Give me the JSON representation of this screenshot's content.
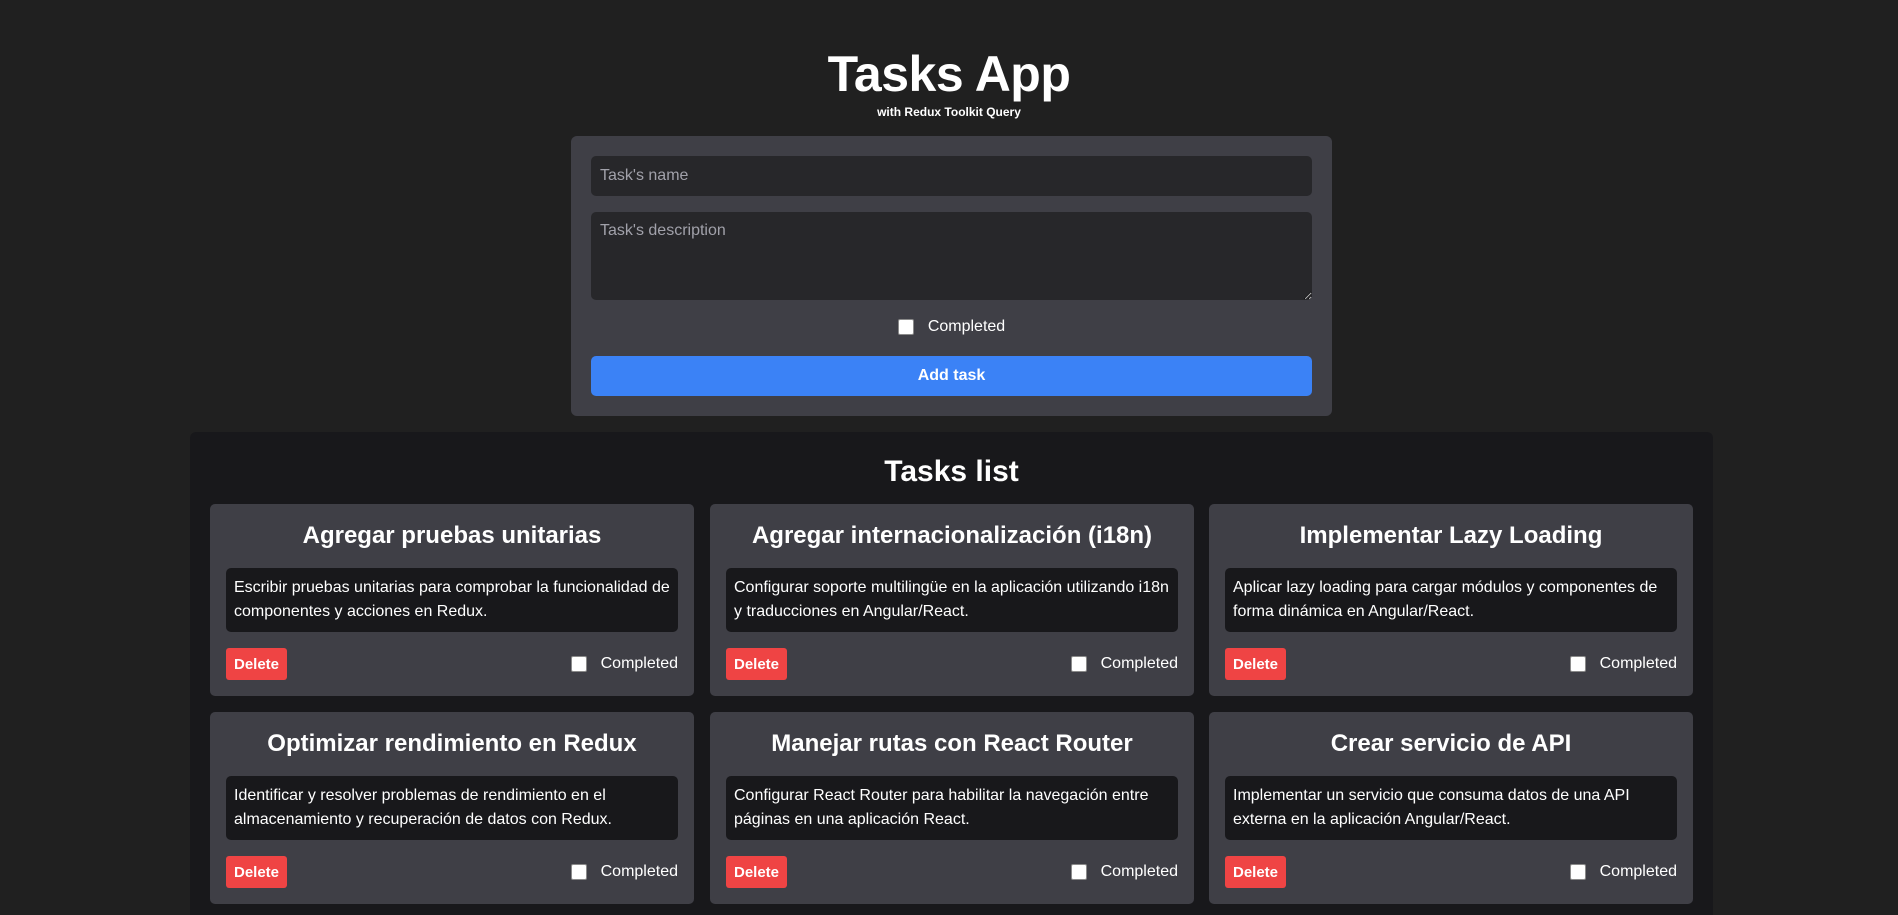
{
  "header": {
    "title": "Tasks App",
    "subtitle": "with Redux Toolkit Query"
  },
  "form": {
    "name_placeholder": "Task's name",
    "description_placeholder": "Task's description",
    "completed_label": "Completed",
    "completed_checked": false,
    "submit_label": "Add task"
  },
  "list": {
    "title": "Tasks list",
    "tasks": [
      {
        "title": "Agregar pruebas unitarias",
        "description": "Escribir pruebas unitarias para comprobar la funcionalidad de componentes y acciones en Redux.",
        "delete_label": "Delete",
        "completed_label": "Completed",
        "completed": false
      },
      {
        "title": "Agregar internacionalización (i18n)",
        "description": "Configurar soporte multilingüe en la aplicación utilizando i18n y traducciones en Angular/React.",
        "delete_label": "Delete",
        "completed_label": "Completed",
        "completed": false
      },
      {
        "title": "Implementar Lazy Loading",
        "description": "Aplicar lazy loading para cargar módulos y componentes de forma dinámica en Angular/React.",
        "delete_label": "Delete",
        "completed_label": "Completed",
        "completed": false
      },
      {
        "title": "Optimizar rendimiento en Redux",
        "description": "Identificar y resolver problemas de rendimiento en el almacenamiento y recuperación de datos con Redux.",
        "delete_label": "Delete",
        "completed_label": "Completed",
        "completed": false
      },
      {
        "title": "Manejar rutas con React Router",
        "description": "Configurar React Router para habilitar la navegación entre páginas en una aplicación React.",
        "delete_label": "Delete",
        "completed_label": "Completed",
        "completed": false
      },
      {
        "title": "Crear servicio de API",
        "description": "Implementar un servicio que consuma datos de una API externa en la aplicación Angular/React.",
        "delete_label": "Delete",
        "completed_label": "Completed",
        "completed": false
      }
    ]
  },
  "colors": {
    "page_background": "#202020",
    "panel_background": "#3f3f46",
    "list_background": "#18181b",
    "accent_blue": "#3b82f6",
    "danger_red": "#ef4444"
  }
}
